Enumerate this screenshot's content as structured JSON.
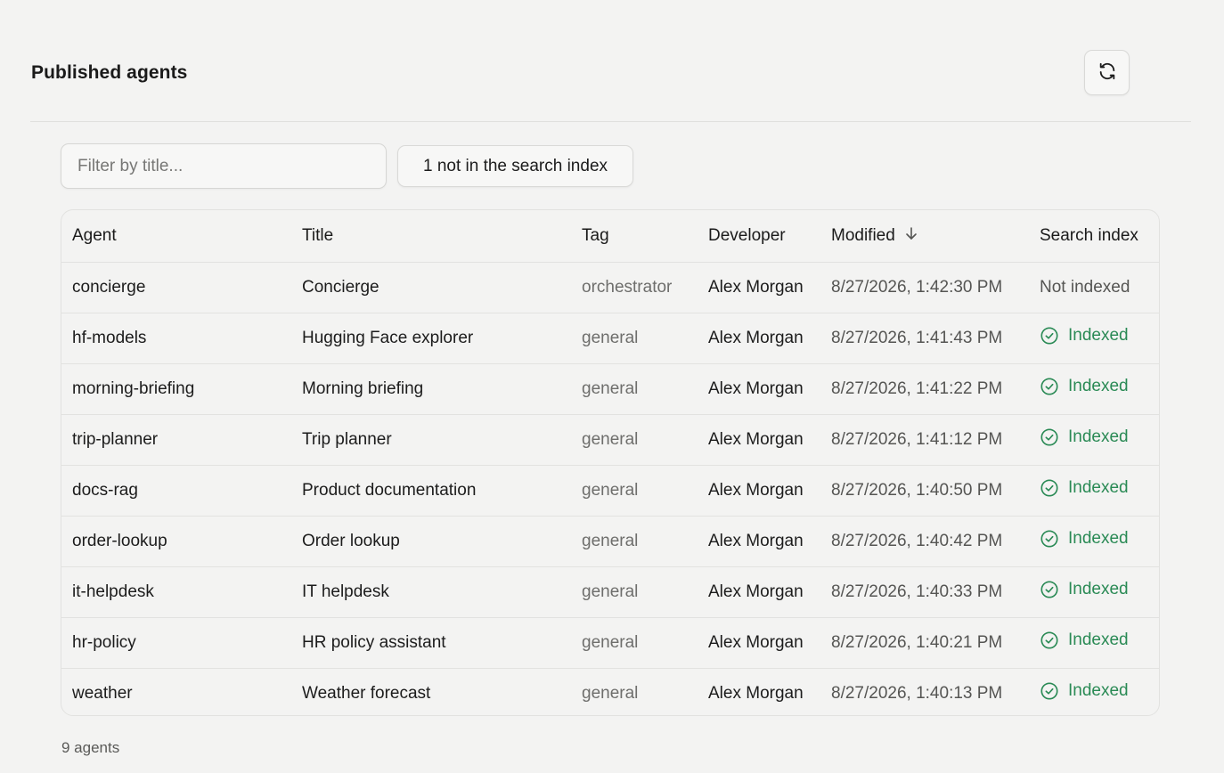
{
  "header": {
    "title": "Published agents",
    "refresh_icon": "refresh-icon"
  },
  "filter": {
    "placeholder": "Filter by title...",
    "value": "",
    "not_indexed_label": "1 not in the search index"
  },
  "table": {
    "columns": [
      "Agent",
      "Title",
      "Tag",
      "Developer",
      "Modified",
      "Search index"
    ],
    "sort_column": "Modified",
    "sort_direction": "descending",
    "sort_icon": "arrow-down-icon",
    "rows": [
      {
        "agent": "concierge",
        "title": "Concierge",
        "tag": "orchestrator",
        "developer": "Alex Morgan",
        "modified": "8/27/2026, 1:42:30 PM",
        "index_status": "Not indexed",
        "indexed": false
      },
      {
        "agent": "hf-models",
        "title": "Hugging Face explorer",
        "tag": "general",
        "developer": "Alex Morgan",
        "modified": "8/27/2026, 1:41:43 PM",
        "index_status": "Indexed",
        "indexed": true
      },
      {
        "agent": "morning-briefing",
        "title": "Morning briefing",
        "tag": "general",
        "developer": "Alex Morgan",
        "modified": "8/27/2026, 1:41:22 PM",
        "index_status": "Indexed",
        "indexed": true
      },
      {
        "agent": "trip-planner",
        "title": "Trip planner",
        "tag": "general",
        "developer": "Alex Morgan",
        "modified": "8/27/2026, 1:41:12 PM",
        "index_status": "Indexed",
        "indexed": true
      },
      {
        "agent": "docs-rag",
        "title": "Product documentation",
        "tag": "general",
        "developer": "Alex Morgan",
        "modified": "8/27/2026, 1:40:50 PM",
        "index_status": "Indexed",
        "indexed": true
      },
      {
        "agent": "order-lookup",
        "title": "Order lookup",
        "tag": "general",
        "developer": "Alex Morgan",
        "modified": "8/27/2026, 1:40:42 PM",
        "index_status": "Indexed",
        "indexed": true
      },
      {
        "agent": "it-helpdesk",
        "title": "IT helpdesk",
        "tag": "general",
        "developer": "Alex Morgan",
        "modified": "8/27/2026, 1:40:33 PM",
        "index_status": "Indexed",
        "indexed": true
      },
      {
        "agent": "hr-policy",
        "title": "HR policy assistant",
        "tag": "general",
        "developer": "Alex Morgan",
        "modified": "8/27/2026, 1:40:21 PM",
        "index_status": "Indexed",
        "indexed": true
      },
      {
        "agent": "weather",
        "title": "Weather forecast",
        "tag": "general",
        "developer": "Alex Morgan",
        "modified": "8/27/2026, 1:40:13 PM",
        "index_status": "Indexed",
        "indexed": true
      }
    ]
  },
  "footer": {
    "count_label": "9 agents"
  },
  "colors": {
    "background": "#f3f3f2",
    "indexed_green": "#2a8a55",
    "muted_text": "#6e6e6c",
    "border": "#e2e2e0"
  }
}
